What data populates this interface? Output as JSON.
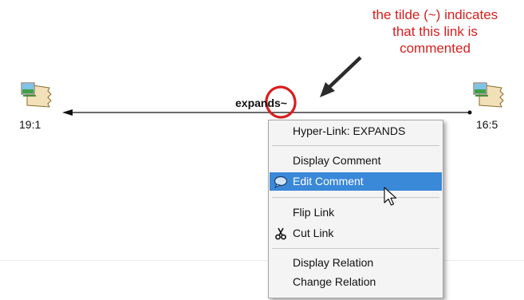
{
  "annotation": {
    "lines": [
      "the tilde (~) indicates",
      "that this link is",
      "commented"
    ],
    "color": "#d81e1e"
  },
  "nodes": {
    "left": {
      "label": "19:1",
      "icon": "image-document-icon"
    },
    "right": {
      "label": "16:5",
      "icon": "image-document-icon"
    }
  },
  "link": {
    "label": "expands~"
  },
  "context_menu": {
    "title": "Hyper-Link: EXPANDS",
    "items": [
      {
        "label": "Display Comment"
      },
      {
        "label": "Edit Comment",
        "icon": "speech-bubble-icon",
        "selected": true
      },
      {
        "label": "Flip Link"
      },
      {
        "label": "Cut Link",
        "icon": "scissors-icon"
      },
      {
        "label": "Display Relation"
      },
      {
        "label": "Change Relation"
      }
    ],
    "selected_color": "#3a88d8"
  }
}
